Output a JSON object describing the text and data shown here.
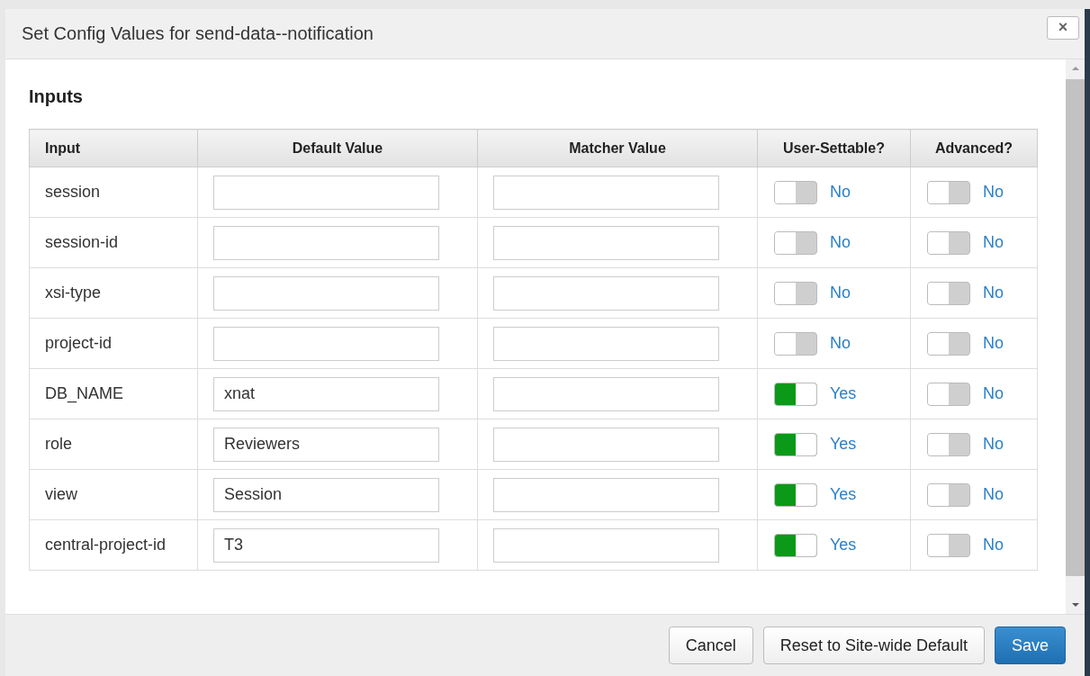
{
  "modal": {
    "title": "Set Config Values for send-data--notification",
    "close": "×"
  },
  "section": "Inputs",
  "table": {
    "columns": [
      "Input",
      "Default Value",
      "Matcher Value",
      "User-Settable?",
      "Advanced?"
    ],
    "rows": [
      {
        "input": "session",
        "default_value": "",
        "matcher_value": "",
        "user_settable": {
          "on": false,
          "label": "No"
        },
        "advanced": {
          "on": false,
          "label": "No"
        }
      },
      {
        "input": "session-id",
        "default_value": "",
        "matcher_value": "",
        "user_settable": {
          "on": false,
          "label": "No"
        },
        "advanced": {
          "on": false,
          "label": "No"
        }
      },
      {
        "input": "xsi-type",
        "default_value": "",
        "matcher_value": "",
        "user_settable": {
          "on": false,
          "label": "No"
        },
        "advanced": {
          "on": false,
          "label": "No"
        }
      },
      {
        "input": "project-id",
        "default_value": "",
        "matcher_value": "",
        "user_settable": {
          "on": false,
          "label": "No"
        },
        "advanced": {
          "on": false,
          "label": "No"
        }
      },
      {
        "input": "DB_NAME",
        "default_value": "xnat",
        "matcher_value": "",
        "user_settable": {
          "on": true,
          "label": "Yes"
        },
        "advanced": {
          "on": false,
          "label": "No"
        }
      },
      {
        "input": "role",
        "default_value": "Reviewers",
        "matcher_value": "",
        "user_settable": {
          "on": true,
          "label": "Yes"
        },
        "advanced": {
          "on": false,
          "label": "No"
        }
      },
      {
        "input": "view",
        "default_value": "Session",
        "matcher_value": "",
        "user_settable": {
          "on": true,
          "label": "Yes"
        },
        "advanced": {
          "on": false,
          "label": "No"
        }
      },
      {
        "input": "central-project-id",
        "default_value": "T3",
        "matcher_value": "",
        "user_settable": {
          "on": true,
          "label": "Yes"
        },
        "advanced": {
          "on": false,
          "label": "No"
        }
      }
    ]
  },
  "buttons": [
    {
      "label": "Cancel",
      "kind": "default"
    },
    {
      "label": "Reset to Site-wide Default",
      "kind": "default"
    },
    {
      "label": "Save",
      "kind": "primary"
    }
  ]
}
